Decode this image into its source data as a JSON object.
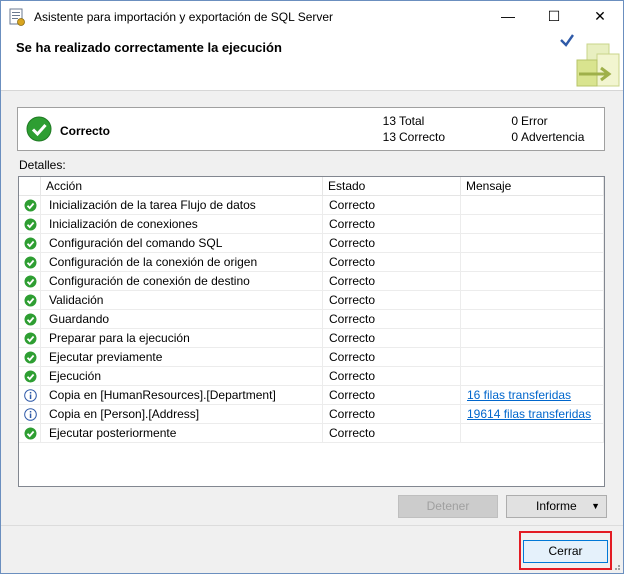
{
  "window": {
    "title": "Asistente para importación y exportación de SQL Server",
    "minimize_glyph": "—",
    "maximize_glyph": "☐",
    "close_glyph": "✕"
  },
  "header": {
    "title": "Se ha realizado correctamente la ejecución"
  },
  "summary": {
    "status_label": "Correcto",
    "total_count": "13",
    "total_label": "Total",
    "success_count": "13",
    "success_label": "Correcto",
    "error_count": "0",
    "error_label": "Error",
    "warning_count": "0",
    "warning_label": "Advertencia"
  },
  "details": {
    "label": "Detalles:",
    "columns": [
      "Acción",
      "Estado",
      "Mensaje"
    ],
    "rows": [
      {
        "icon": "success-icon",
        "action": "Inicialización de la tarea Flujo de datos",
        "status": "Correcto",
        "message": ""
      },
      {
        "icon": "success-icon",
        "action": "Inicialización de conexiones",
        "status": "Correcto",
        "message": ""
      },
      {
        "icon": "success-icon",
        "action": "Configuración del comando SQL",
        "status": "Correcto",
        "message": ""
      },
      {
        "icon": "success-icon",
        "action": "Configuración de la conexión de origen",
        "status": "Correcto",
        "message": ""
      },
      {
        "icon": "success-icon",
        "action": "Configuración de conexión de destino",
        "status": "Correcto",
        "message": ""
      },
      {
        "icon": "success-icon",
        "action": "Validación",
        "status": "Correcto",
        "message": ""
      },
      {
        "icon": "success-icon",
        "action": "Guardando",
        "status": "Correcto",
        "message": ""
      },
      {
        "icon": "success-icon",
        "action": "Preparar para la ejecución",
        "status": "Correcto",
        "message": ""
      },
      {
        "icon": "success-icon",
        "action": "Ejecutar previamente",
        "status": "Correcto",
        "message": ""
      },
      {
        "icon": "success-icon",
        "action": "Ejecución",
        "status": "Correcto",
        "message": ""
      },
      {
        "icon": "info-icon",
        "action": "Copia en [HumanResources].[Department]",
        "status": "Correcto",
        "message": "16 filas transferidas"
      },
      {
        "icon": "info-icon",
        "action": "Copia en [Person].[Address]",
        "status": "Correcto",
        "message": "19614 filas transferidas"
      },
      {
        "icon": "success-icon",
        "action": "Ejecutar posteriormente",
        "status": "Correcto",
        "message": ""
      }
    ]
  },
  "buttons": {
    "stop": "Detener",
    "report": "Informe",
    "report_arrow": "▼",
    "close": "Cerrar"
  },
  "colors": {
    "success": "#2e9e32",
    "info": "#2f5aa8",
    "link": "#0066cc",
    "highlight": "#e31b23"
  }
}
